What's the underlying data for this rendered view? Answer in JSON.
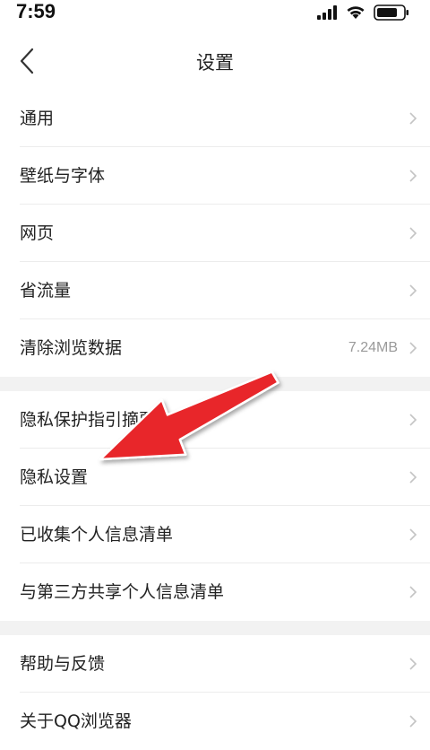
{
  "status_bar": {
    "time": "7:59"
  },
  "header": {
    "title": "设置"
  },
  "groups": [
    {
      "items": [
        {
          "label": "通用"
        },
        {
          "label": "壁纸与字体"
        },
        {
          "label": "网页"
        },
        {
          "label": "省流量"
        },
        {
          "label": "清除浏览数据",
          "value": "7.24MB"
        }
      ]
    },
    {
      "items": [
        {
          "label": "隐私保护指引摘要"
        },
        {
          "label": "隐私设置"
        },
        {
          "label": "已收集个人信息清单"
        },
        {
          "label": "与第三方共享个人信息清单"
        }
      ]
    },
    {
      "items": [
        {
          "label": "帮助与反馈"
        },
        {
          "label": "关于QQ浏览器"
        }
      ]
    }
  ],
  "colors": {
    "annotation_arrow": "#e8262a",
    "chevron": "#c4c4c4",
    "divider": "#ececec",
    "section_gap": "#f2f2f2"
  }
}
